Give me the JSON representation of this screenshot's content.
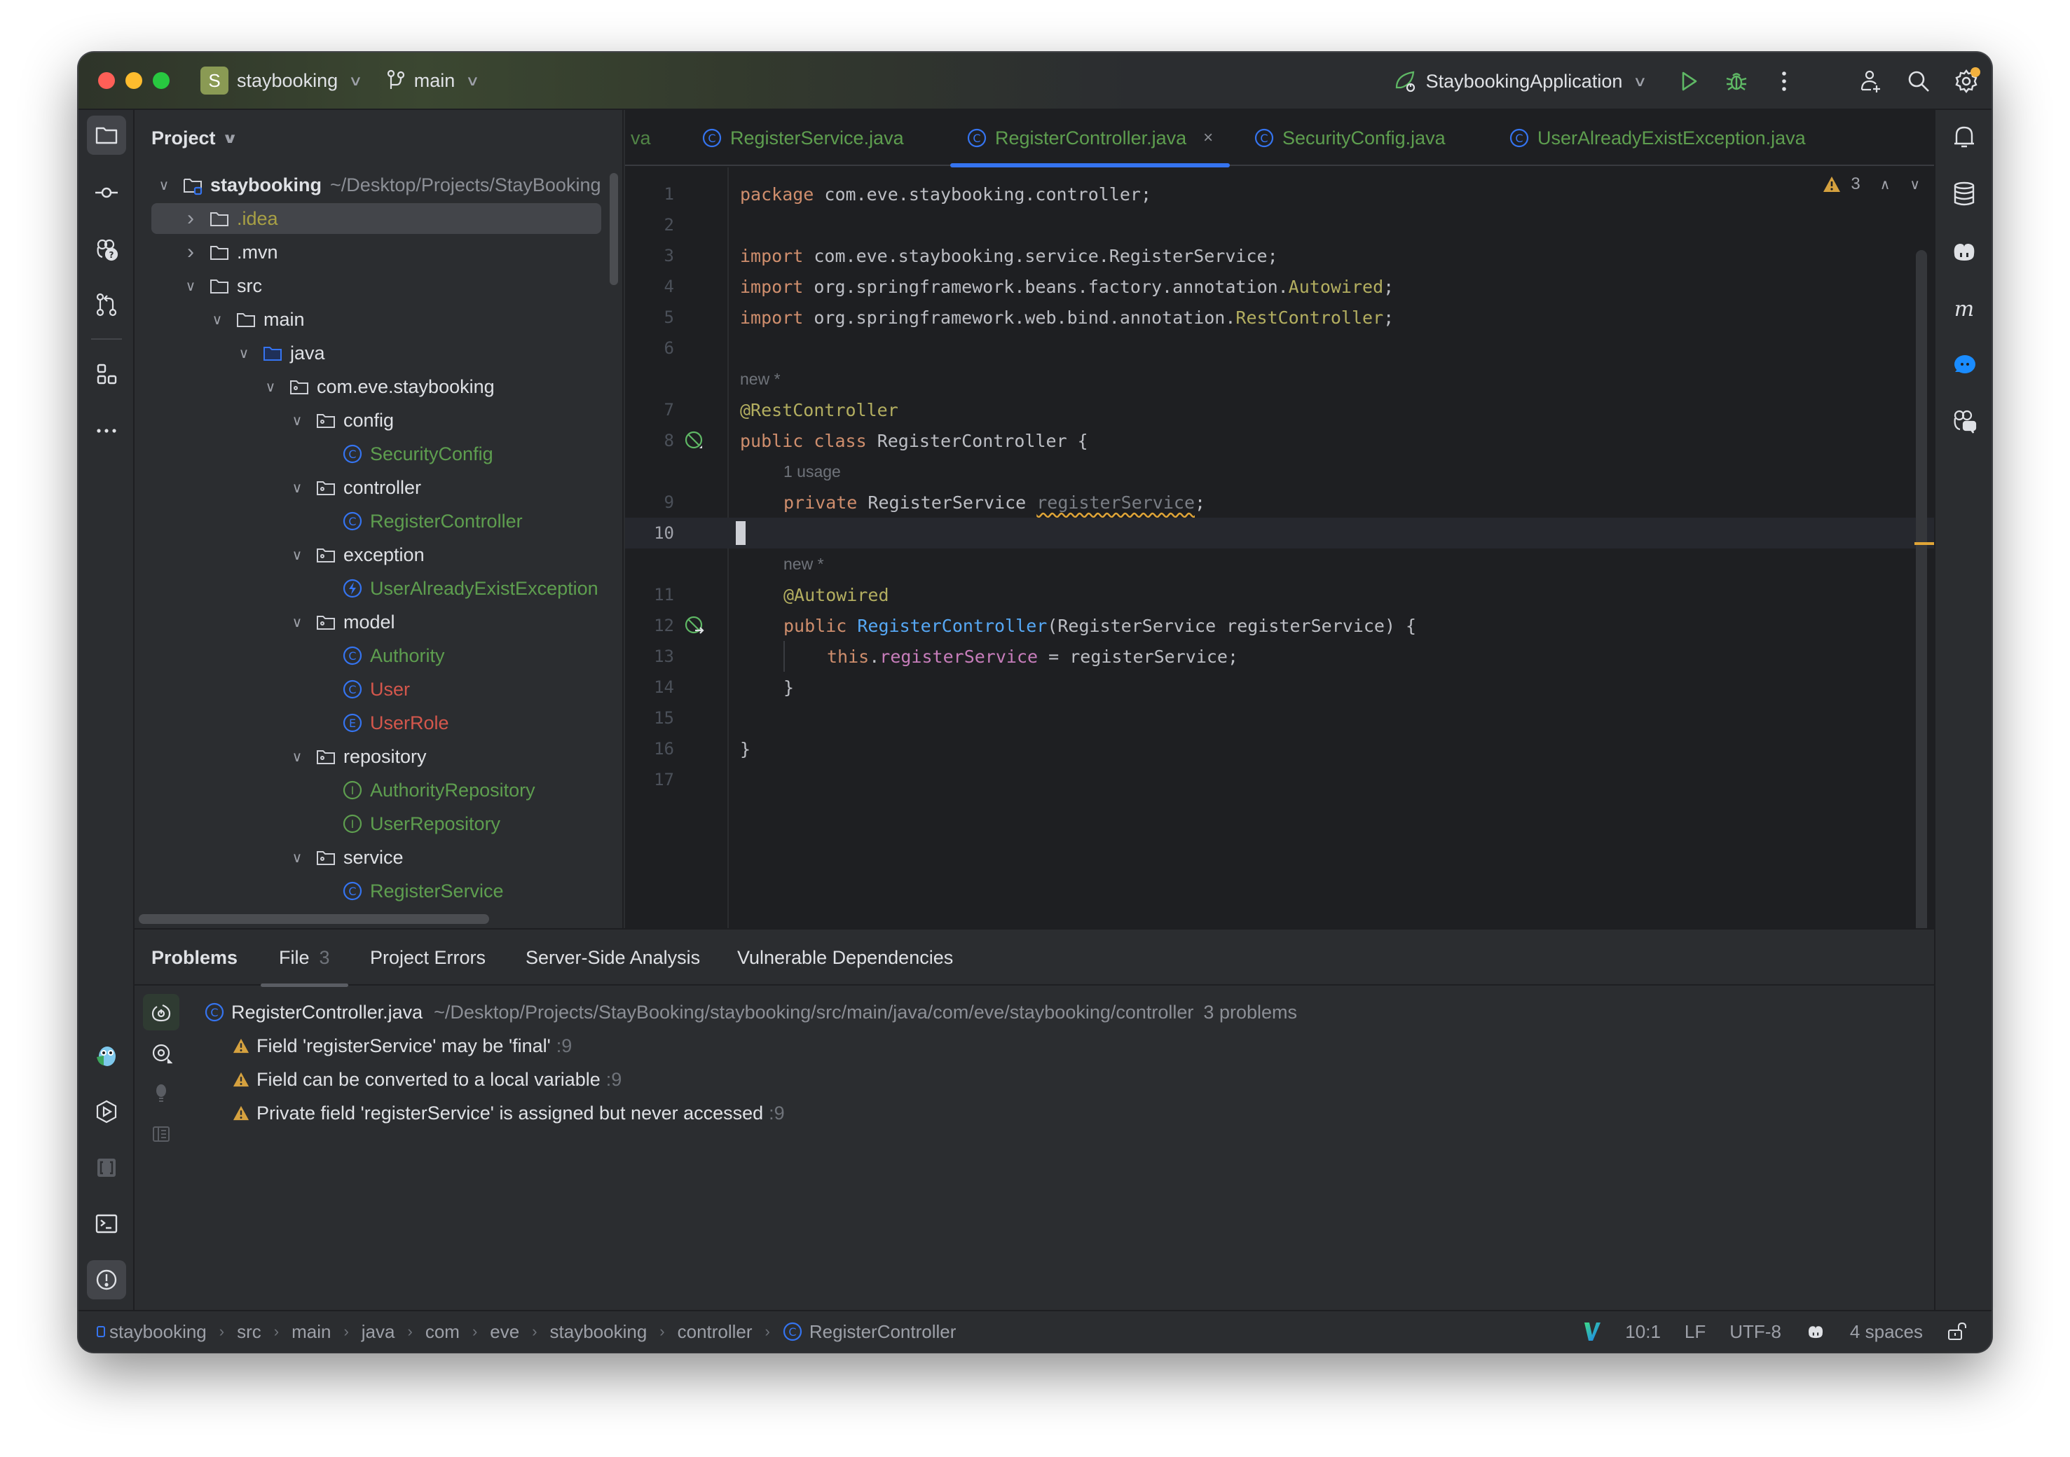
{
  "titlebar": {
    "project_badge": "S",
    "project_name": "staybooking",
    "branch": "main",
    "run_config": "StaybookingApplication"
  },
  "project_panel": {
    "title": "Project",
    "tree": [
      {
        "label": "staybooking",
        "path": "~/Desktop/Projects/StayBooking",
        "depth": 0,
        "expanded": true,
        "icon": "module-folder-icon",
        "style": "bold"
      },
      {
        "label": ".idea",
        "depth": 1,
        "expanded": false,
        "icon": "folder-icon",
        "style": "olive",
        "selected": true
      },
      {
        "label": ".mvn",
        "depth": 1,
        "expanded": false,
        "icon": "folder-icon",
        "style": "normal"
      },
      {
        "label": "src",
        "depth": 1,
        "expanded": true,
        "icon": "folder-icon",
        "style": "normal"
      },
      {
        "label": "main",
        "depth": 2,
        "expanded": true,
        "icon": "folder-icon",
        "style": "normal"
      },
      {
        "label": "java",
        "depth": 3,
        "expanded": true,
        "icon": "source-folder-icon",
        "style": "normal"
      },
      {
        "label": "com.eve.staybooking",
        "depth": 4,
        "expanded": true,
        "icon": "package-icon",
        "style": "normal"
      },
      {
        "label": "config",
        "depth": 5,
        "expanded": true,
        "icon": "package-icon",
        "style": "normal"
      },
      {
        "label": "SecurityConfig",
        "depth": 6,
        "icon": "class-icon",
        "style": "green"
      },
      {
        "label": "controller",
        "depth": 5,
        "expanded": true,
        "icon": "package-icon",
        "style": "normal"
      },
      {
        "label": "RegisterController",
        "depth": 6,
        "icon": "class-icon",
        "style": "green"
      },
      {
        "label": "exception",
        "depth": 5,
        "expanded": true,
        "icon": "package-icon",
        "style": "normal"
      },
      {
        "label": "UserAlreadyExistException",
        "depth": 6,
        "icon": "exception-class-icon",
        "style": "green"
      },
      {
        "label": "model",
        "depth": 5,
        "expanded": true,
        "icon": "package-icon",
        "style": "normal"
      },
      {
        "label": "Authority",
        "depth": 6,
        "icon": "class-icon",
        "style": "green"
      },
      {
        "label": "User",
        "depth": 6,
        "icon": "class-icon",
        "style": "red"
      },
      {
        "label": "UserRole",
        "depth": 6,
        "icon": "enum-icon",
        "style": "red"
      },
      {
        "label": "repository",
        "depth": 5,
        "expanded": true,
        "icon": "package-icon",
        "style": "normal"
      },
      {
        "label": "AuthorityRepository",
        "depth": 6,
        "icon": "interface-icon",
        "style": "green"
      },
      {
        "label": "UserRepository",
        "depth": 6,
        "icon": "interface-icon",
        "style": "green"
      },
      {
        "label": "service",
        "depth": 5,
        "expanded": true,
        "icon": "package-icon",
        "style": "normal"
      },
      {
        "label": "RegisterService",
        "depth": 6,
        "icon": "class-icon",
        "style": "green"
      }
    ]
  },
  "editor": {
    "partial_tab": "va",
    "tabs": [
      {
        "label": "RegisterService.java",
        "active": false
      },
      {
        "label": "RegisterController.java",
        "active": true,
        "closable": true
      },
      {
        "label": "SecurityConfig.java",
        "active": false
      },
      {
        "label": "UserAlreadyExistException.java",
        "active": false
      }
    ],
    "close_glyph": "×",
    "warning_count": "3",
    "current_line": 10,
    "hints": {
      "new_before_class": "new *",
      "usage_before_field": "1 usage",
      "new_before_ctor": "new *"
    },
    "lines": {
      "l1": {
        "n": "1",
        "kw": "package",
        "rest": " com.eve.staybooking.controller;"
      },
      "l2": {
        "n": "2"
      },
      "l3": {
        "n": "3",
        "kw": "import",
        "rest": " com.eve.staybooking.service.RegisterService;"
      },
      "l4": {
        "n": "4",
        "kw": "import",
        "rest": " org.springframework.beans.factory.annotation.",
        "ann": "Autowired",
        "end": ";"
      },
      "l5": {
        "n": "5",
        "kw": "import",
        "rest": " org.springframework.web.bind.annotation.",
        "ann": "RestController",
        "end": ";"
      },
      "l6": {
        "n": "6"
      },
      "l7": {
        "n": "7",
        "ann": "@RestController"
      },
      "l8": {
        "n": "8",
        "kw1": "public",
        "kw2": "class",
        "rest": " RegisterController {"
      },
      "l9": {
        "n": "9",
        "kw": "private",
        "type": " RegisterService ",
        "field": "registerService",
        "end": ";"
      },
      "l10": {
        "n": "10"
      },
      "l11": {
        "n": "11",
        "ann": "@Autowired"
      },
      "l12": {
        "n": "12",
        "kw": "public",
        "fn": "RegisterController",
        "rest": "(RegisterService registerService) {"
      },
      "l13": {
        "n": "13",
        "kw": "this",
        "dot": ".",
        "field": "registerService",
        "rest": " = registerService;"
      },
      "l14": {
        "n": "14",
        "rest": "}"
      },
      "l15": {
        "n": "15"
      },
      "l16": {
        "n": "16",
        "rest": "}"
      },
      "l17": {
        "n": "17"
      }
    }
  },
  "problems": {
    "tabs": [
      {
        "label": "Problems",
        "bold": true
      },
      {
        "label": "File",
        "count": "3",
        "active": true
      },
      {
        "label": "Project Errors"
      },
      {
        "label": "Server-Side Analysis"
      },
      {
        "label": "Vulnerable Dependencies"
      }
    ],
    "file": {
      "name": "RegisterController.java",
      "path": "~/Desktop/Projects/StayBooking/staybooking/src/main/java/com/eve/staybooking/controller",
      "count": "3 problems"
    },
    "issues": [
      {
        "message": "Field 'registerService' may be 'final'",
        "line": ":9",
        "severity": "warning"
      },
      {
        "message": "Field can be converted to a local variable",
        "line": ":9",
        "severity": "warning"
      },
      {
        "message": "Private field 'registerService' is assigned but never accessed",
        "line": ":9",
        "severity": "warning"
      }
    ]
  },
  "statusbar": {
    "breadcrumbs": [
      "staybooking",
      "src",
      "main",
      "java",
      "com",
      "eve",
      "staybooking",
      "controller",
      "RegisterController"
    ],
    "cursor": "10:1",
    "line_ending": "LF",
    "encoding": "UTF-8",
    "indent": "4 spaces"
  },
  "colors": {
    "accent": "#3574f0",
    "warning": "#e0a537",
    "run_green": "#5fb865",
    "class_green": "#5e9e4f",
    "class_red": "#d4574c"
  }
}
